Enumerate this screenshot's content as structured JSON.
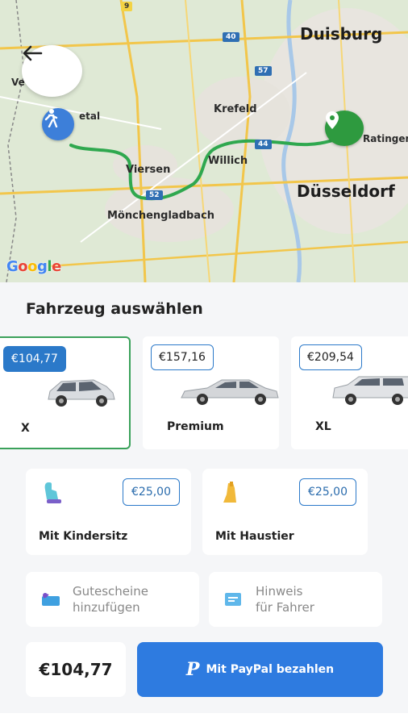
{
  "map": {
    "cities": {
      "duisburg": "Duisburg",
      "duesseldorf": "Düsseldorf",
      "krefeld": "Krefeld",
      "willich": "Willich",
      "viersen": "Viersen",
      "moenchengladbach": "Mönchengladbach",
      "ratingen": "Ratingen",
      "nettetal": "etal",
      "venlo": "Ve"
    },
    "roads": {
      "r9": "9",
      "r40": "40",
      "r57": "57",
      "r44": "44",
      "r52": "52"
    },
    "attribution": "Google",
    "back_icon": "arrow-left-icon",
    "start_icon": "person-walking-icon",
    "end_icon": "location-pin-icon",
    "route_color": "#2fa84f"
  },
  "section_title": "Fahrzeug auswählen",
  "vehicles": [
    {
      "price": "€104,77",
      "name": "X",
      "selected": true
    },
    {
      "price": "€157,16",
      "name": "Premium",
      "selected": false
    },
    {
      "price": "€209,54",
      "name": "XL",
      "selected": false
    }
  ],
  "options": [
    {
      "price": "€25,00",
      "label": "Mit Kindersitz",
      "icon": "child-seat-icon"
    },
    {
      "price": "€25,00",
      "label": "Mit Haustier",
      "icon": "pet-icon"
    }
  ],
  "extras": [
    {
      "line1": "Gutescheine",
      "line2": "hinzufügen",
      "icon": "voucher-icon"
    },
    {
      "line1": "Hinweis",
      "line2": "für Fahrer",
      "icon": "note-icon"
    }
  ],
  "total": "€104,77",
  "pay_label": "Mit PayPal bezahlen",
  "pay_logo": "P",
  "colors": {
    "accent": "#2e7be0",
    "selected_border": "#3aa15a"
  }
}
